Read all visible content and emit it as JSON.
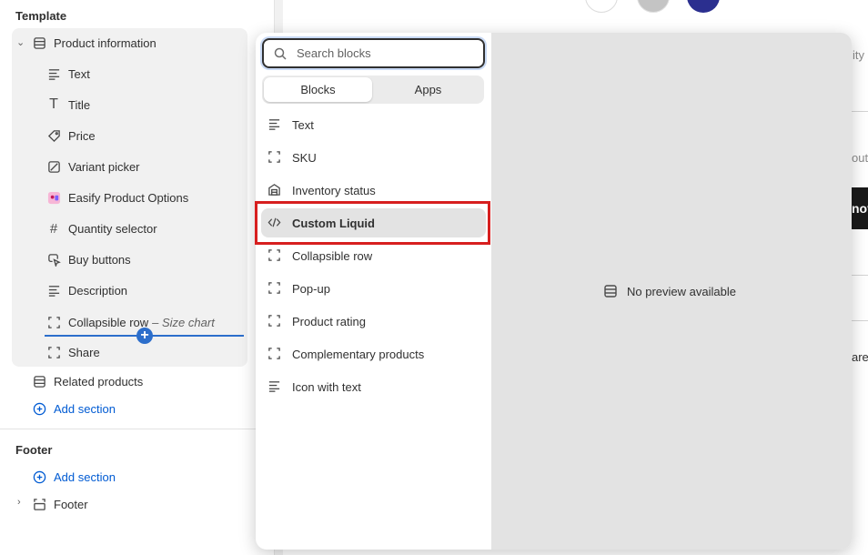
{
  "sidebar": {
    "template_title": "Template",
    "product_section": "Product information",
    "blocks": [
      {
        "label": "Text",
        "icon": "text-lines-icon"
      },
      {
        "label": "Title",
        "icon": "title-icon"
      },
      {
        "label": "Price",
        "icon": "price-tag-icon"
      },
      {
        "label": "Variant picker",
        "icon": "variant-icon"
      },
      {
        "label": "Easify Product Options",
        "icon": "app-logo-icon"
      },
      {
        "label": "Quantity selector",
        "icon": "hash-icon"
      },
      {
        "label": "Buy buttons",
        "icon": "cursor-button-icon"
      },
      {
        "label": "Description",
        "icon": "text-lines-icon"
      },
      {
        "label": "Collapsible row",
        "icon": "dashed-square-icon",
        "suffix": "– Size chart"
      },
      {
        "label": "Share",
        "icon": "dashed-square-icon"
      }
    ],
    "related_products": "Related products",
    "add_section": "Add section",
    "footer_title": "Footer",
    "footer_add_section": "Add section",
    "footer_item": "Footer"
  },
  "background": {
    "frag1": "ity",
    "frag2": "out",
    "frag3": "nov",
    "frag4": "are"
  },
  "popup": {
    "search_placeholder": "Search blocks",
    "tabs": [
      "Blocks",
      "Apps"
    ],
    "active_tab": "Blocks",
    "blocks": [
      {
        "label": "Text",
        "icon": "text-lines-icon"
      },
      {
        "label": "SKU",
        "icon": "dashed-square-icon"
      },
      {
        "label": "Inventory status",
        "icon": "inventory-icon"
      },
      {
        "label": "Custom Liquid",
        "icon": "code-icon",
        "selected": true
      },
      {
        "label": "Collapsible row",
        "icon": "dashed-square-icon"
      },
      {
        "label": "Pop-up",
        "icon": "dashed-square-icon"
      },
      {
        "label": "Product rating",
        "icon": "dashed-square-icon"
      },
      {
        "label": "Complementary products",
        "icon": "dashed-square-icon"
      },
      {
        "label": "Icon with text",
        "icon": "text-lines-icon"
      }
    ],
    "no_preview": "No preview available"
  },
  "colors": {
    "accent_blue": "#005bd3",
    "highlight_red": "#d71f1f",
    "swatch_white": "#ffffff",
    "swatch_gray": "#c4c4c4",
    "swatch_navy": "#2b2f8f"
  }
}
